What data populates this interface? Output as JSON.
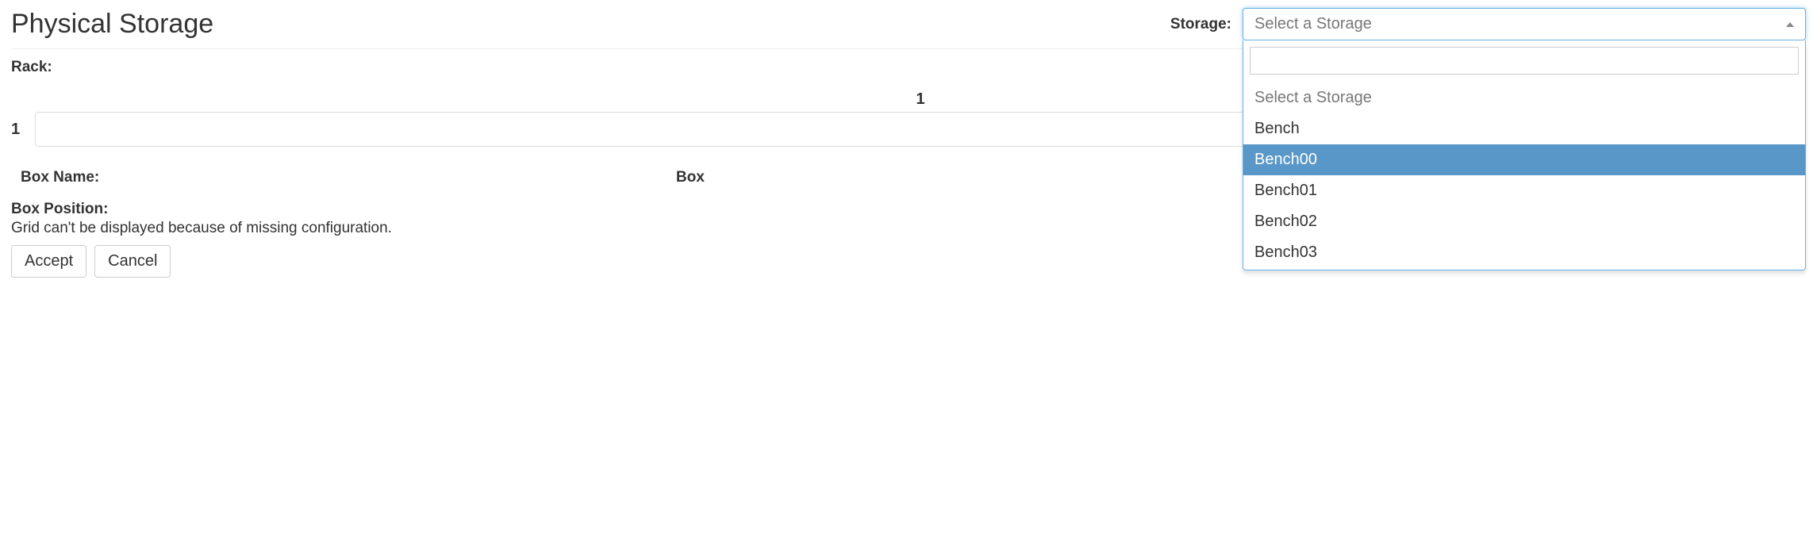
{
  "header": {
    "title": "Physical Storage",
    "storage_label": "Storage:"
  },
  "storage_select": {
    "placeholder": "Select a Storage",
    "search_value": "",
    "options": [
      {
        "label": "Select a Storage",
        "placeholder": true,
        "highlighted": false
      },
      {
        "label": "Bench",
        "placeholder": false,
        "highlighted": false
      },
      {
        "label": "Bench00",
        "placeholder": false,
        "highlighted": true
      },
      {
        "label": "Bench01",
        "placeholder": false,
        "highlighted": false
      },
      {
        "label": "Bench02",
        "placeholder": false,
        "highlighted": false
      },
      {
        "label": "Bench03",
        "placeholder": false,
        "highlighted": false
      }
    ]
  },
  "rack": {
    "label": "Rack:",
    "col_header": "1",
    "row_header": "1",
    "cell_value": ""
  },
  "box": {
    "name_label": "Box Name:",
    "other_label": "Box",
    "position_label": "Box Position:",
    "grid_message": "Grid can't be displayed because of missing configuration."
  },
  "buttons": {
    "accept": "Accept",
    "cancel": "Cancel"
  }
}
